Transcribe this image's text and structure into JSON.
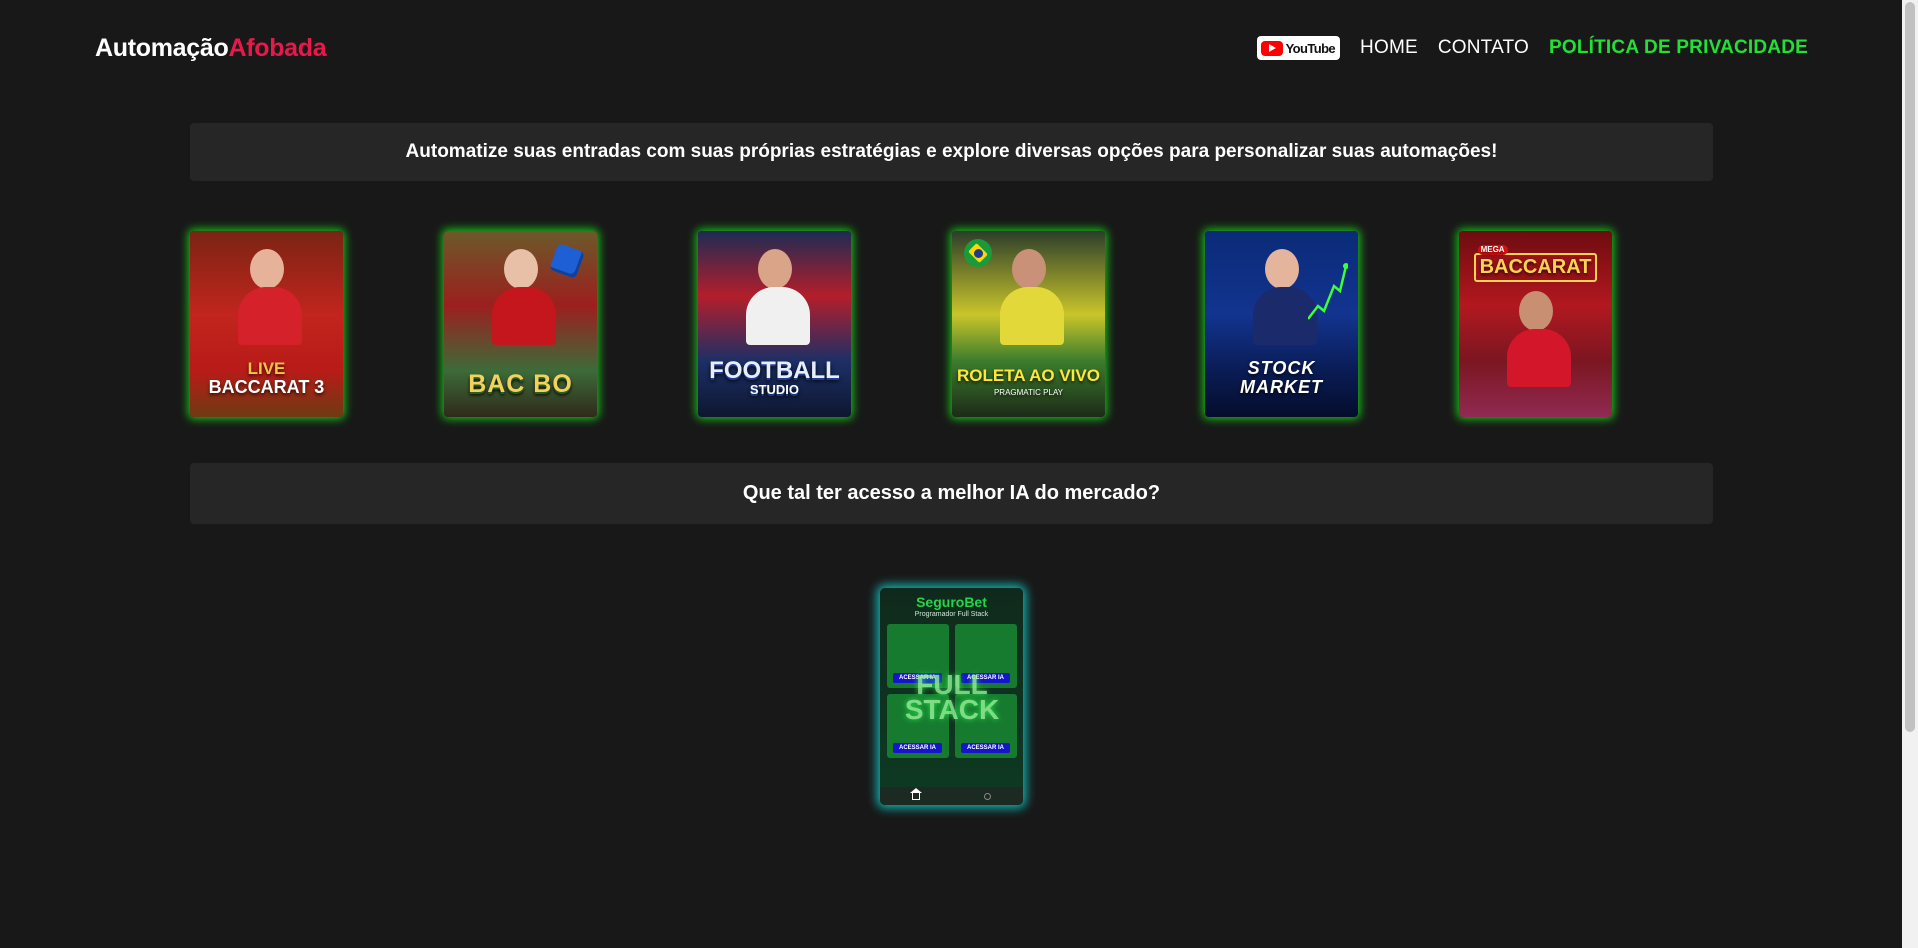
{
  "header": {
    "logo_part1": "Automação",
    "logo_part2": "Afobada",
    "youtube_label": "YouTube",
    "nav": [
      "HOME",
      "CONTATO",
      "POLÍTICA DE PRIVACIDADE"
    ]
  },
  "banner1": "Automatize suas entradas com suas próprias estratégias e explore diversas opções para personalizar suas automações!",
  "games": [
    {
      "title_top": "LIVE",
      "title": "BACCARAT 3"
    },
    {
      "title": "BAC BO"
    },
    {
      "title": "FOOTBALL",
      "subtitle": "STUDIO"
    },
    {
      "title": "ROLETA AO VIVO",
      "subtitle": "PRAGMATIC PLAY"
    },
    {
      "title": "STOCK MARKET"
    },
    {
      "title_top": "MEGA",
      "title": "BACCARAT"
    }
  ],
  "banner2": "Que tal ter acesso a melhor IA do mercado?",
  "app": {
    "brand": "SeguroBet",
    "subtitle": "Programador Full Stack",
    "overlay": "FULL STACK",
    "button_label": "ACESSAR IA"
  },
  "colors": {
    "background": "#181818",
    "accent_red": "#e8184b",
    "accent_green": "#22e034",
    "card_glow": "#17c317",
    "app_glow": "#12b9b5"
  }
}
